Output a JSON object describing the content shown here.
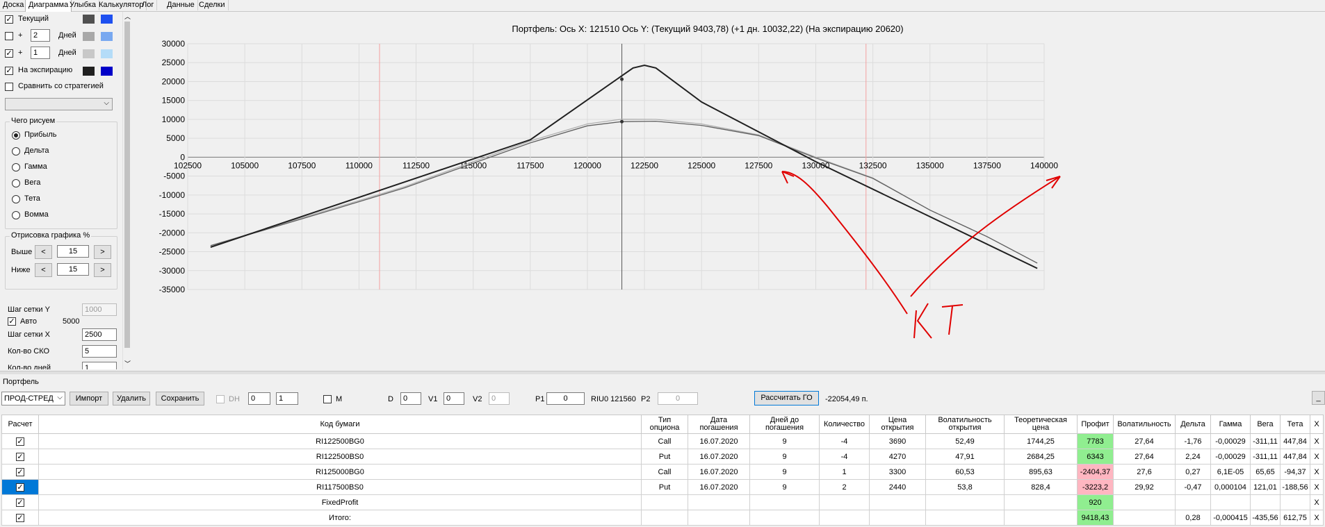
{
  "tabs": [
    "Доска",
    "Диаграмма",
    "Улыбка",
    "Калькулятор",
    "Лог",
    "Данные",
    "Сделки"
  ],
  "left": {
    "current": {
      "label": "Текущий",
      "checked": true,
      "colors": [
        "#505050",
        "#1e50f0"
      ]
    },
    "plus1": {
      "prefix": "+",
      "value": "2",
      "unit": "Дней",
      "checked": false,
      "colors": [
        "#a8a8a8",
        "#78a8f0"
      ]
    },
    "plus2": {
      "prefix": "+",
      "value": "1",
      "unit": "Дней",
      "checked": true,
      "colors": [
        "#c8c8c8",
        "#b4dcf8"
      ]
    },
    "expiry": {
      "label": "На экспирацию",
      "checked": true,
      "colors": [
        "#202020",
        "#0000c8"
      ]
    },
    "compare": {
      "label": "Сравнить со стратегией",
      "checked": false
    },
    "draw_group": "Чего рисуем",
    "radios": [
      "Прибыль",
      "Дельта",
      "Гамма",
      "Вега",
      "Тета",
      "Вомма"
    ],
    "selected_radio": "Прибыль",
    "render_group": "Отрисовка графика %",
    "above_label": "Выше",
    "above_value": "15",
    "below_label": "Ниже",
    "below_value": "15",
    "stepper_prev": "<",
    "stepper_next": ">",
    "grid_y_label": "Шаг сетки Y",
    "grid_y_value": "1000",
    "auto_label": "Авто",
    "auto_value": "5000",
    "grid_x_label": "Шаг сетки X",
    "grid_x_value": "2500",
    "sko_label": "Кол-во СКО",
    "sko_value": "5",
    "days_label": "Кол-во дней",
    "days_value": "1"
  },
  "chart_data": {
    "type": "line",
    "title": "Портфель: Ось X:  121510 Ось Y:  (Текущий 9403,78)  (+1 дн. 10032,22)  (На экспирацию 20620)",
    "xlim": [
      102500,
      140000
    ],
    "ylim": [
      -35000,
      30000
    ],
    "xticks": [
      102500,
      105000,
      107500,
      110000,
      112500,
      115000,
      117500,
      120000,
      122500,
      125000,
      127500,
      130000,
      132500,
      135000,
      137500,
      140000
    ],
    "yticks": [
      30000,
      25000,
      20000,
      15000,
      10000,
      5000,
      0,
      -5000,
      -10000,
      -15000,
      -20000,
      -25000,
      -30000,
      -35000
    ],
    "cursor_x": 121510,
    "sd_lines_x": [
      110900,
      132200
    ],
    "series": [
      {
        "color": "#202020",
        "points": [
          [
            103500,
            -23800
          ],
          [
            117500,
            4600
          ],
          [
            122000,
            23600
          ],
          [
            122500,
            24300
          ],
          [
            123000,
            23600
          ],
          [
            125000,
            14600
          ],
          [
            130000,
            -1200
          ],
          [
            139700,
            -29400
          ]
        ]
      },
      {
        "color": "#606060",
        "points": [
          [
            103500,
            -23400
          ],
          [
            106000,
            -19000
          ],
          [
            109000,
            -13600
          ],
          [
            112000,
            -8100
          ],
          [
            115000,
            -1600
          ],
          [
            117500,
            3800
          ],
          [
            120000,
            8300
          ],
          [
            121500,
            9403.78
          ],
          [
            123000,
            9500
          ],
          [
            125000,
            8400
          ],
          [
            127500,
            5700
          ],
          [
            130000,
            -200
          ],
          [
            132500,
            -5600
          ],
          [
            135000,
            -14000
          ],
          [
            137500,
            -21000
          ],
          [
            139700,
            -28000
          ]
        ]
      },
      {
        "color": "#b0b0b0",
        "points": [
          [
            103500,
            -23400
          ],
          [
            106000,
            -18800
          ],
          [
            109000,
            -13300
          ],
          [
            112000,
            -7800
          ],
          [
            115000,
            -1200
          ],
          [
            117500,
            4300
          ],
          [
            120000,
            8800
          ],
          [
            121500,
            10032.22
          ],
          [
            123000,
            10000
          ],
          [
            125000,
            8800
          ],
          [
            127500,
            5900
          ],
          [
            130000,
            0
          ],
          [
            132500,
            -5500
          ],
          [
            135000,
            -14000
          ],
          [
            137500,
            -21000
          ],
          [
            139700,
            -28000
          ]
        ]
      }
    ],
    "markers": [
      [
        121510,
        20620
      ],
      [
        121510,
        9403.78
      ]
    ],
    "annotation": "КТ"
  },
  "bottom": {
    "portfolio_label": "Портфель",
    "strategy_select": "ПРОД-СТРЕД",
    "import_btn": "Импорт",
    "delete_btn": "Удалить",
    "save_btn": "Сохранить",
    "dh_label": "DH",
    "dh_v1": "0",
    "dh_v2": "1",
    "m_label": "M",
    "d_label": "D",
    "d_value": "0",
    "v1_label": "V1",
    "v1_value": "0",
    "v2_label": "V2",
    "v2_value": "0",
    "p1_label": "P1",
    "p1_value": "0",
    "riu_label": "RIU0 121560",
    "p2_label": "P2",
    "p2_value": "0",
    "calc_btn": "Рассчитать ГО",
    "go_value": "-22054,49 п.",
    "small_btn": "_"
  },
  "table": {
    "headers": [
      "Расчет",
      "Код бумаги",
      "Тип\nопциона",
      "Дата\nпогашения",
      "Дней до\nпогашения",
      "Количество",
      "Цена\nоткрытия",
      "Волатильность\nоткрытия",
      "Теоретическая\nцена",
      "Профит",
      "Волатильность",
      "Дельта",
      "Гамма",
      "Вега",
      "Тета",
      "X"
    ],
    "rows": [
      [
        "RI122500BG0",
        "Call",
        "16.07.2020",
        "9",
        "-4",
        "3690",
        "52,49",
        "1744,25",
        "7783",
        "27,64",
        "-1,76",
        "-0,00029",
        "-311,11",
        "447,84",
        "X"
      ],
      [
        "RI122500BS0",
        "Put",
        "16.07.2020",
        "9",
        "-4",
        "4270",
        "47,91",
        "2684,25",
        "6343",
        "27,64",
        "2,24",
        "-0,00029",
        "-311,11",
        "447,84",
        "X"
      ],
      [
        "RI125000BG0",
        "Call",
        "16.07.2020",
        "9",
        "1",
        "3300",
        "60,53",
        "895,63",
        "-2404,37",
        "27,6",
        "0,27",
        "6,1E-05",
        "65,65",
        "-94,37",
        "X"
      ],
      [
        "RI117500BS0",
        "Put",
        "16.07.2020",
        "9",
        "2",
        "2440",
        "53,8",
        "828,4",
        "-3223,2",
        "29,92",
        "-0,47",
        "0,000104",
        "121,01",
        "-188,56",
        "X"
      ],
      [
        "FixedProfit",
        "",
        "",
        "",
        "",
        "",
        "",
        "",
        "920",
        "",
        "",
        "",
        "",
        "",
        "X"
      ],
      [
        "Итого:",
        "",
        "",
        "",
        "",
        "",
        "",
        "",
        "9418,43",
        "",
        "0,28",
        "-0,000415",
        "-435,56",
        "612,75",
        "X"
      ]
    ],
    "profit_states": [
      "pos",
      "pos",
      "neg",
      "neg",
      "pos",
      "pos"
    ]
  }
}
